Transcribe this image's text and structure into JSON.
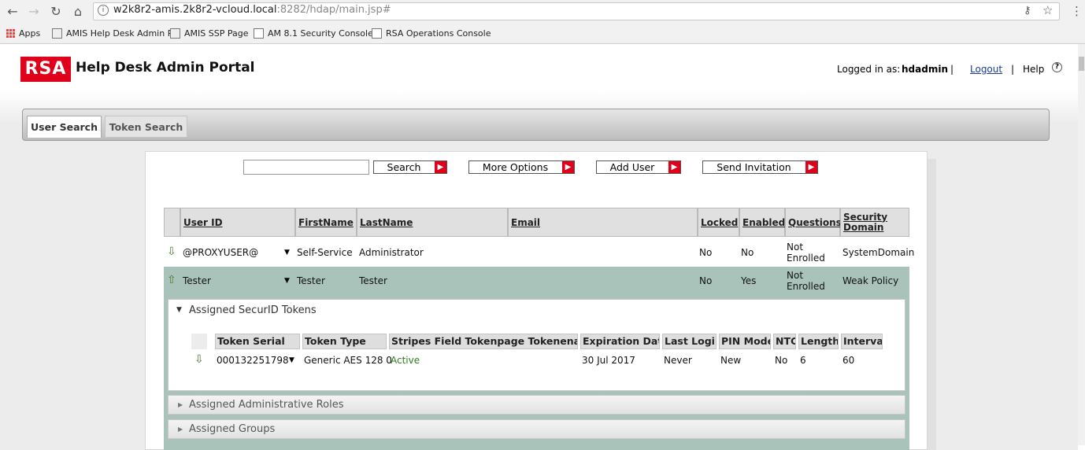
{
  "browser": {
    "url_host": "w2k8r2-amis.2k8r2-vcloud.local",
    "url_rest": ":8282/hdap/main.jsp#",
    "bookmarks": [
      "Apps",
      "AMIS Help Desk Admin P",
      "AMIS SSP Page",
      "AM 8.1 Security Console",
      "RSA Operations Console"
    ]
  },
  "header": {
    "logo_text": "RSA",
    "title": "Help Desk Admin Portal",
    "logged_in_label": "Logged in as:",
    "username": "hdadmin",
    "sep1": "|",
    "logout": "Logout",
    "sep2": "|",
    "help": "Help"
  },
  "tabs": [
    "User Search",
    "Token Search"
  ],
  "toolbar": {
    "search_value": "",
    "search": "Search",
    "more_options": "More Options",
    "add_user": "Add User",
    "send_invitation": "Send Invitation"
  },
  "users_table": {
    "columns": [
      "User ID",
      "FirstName",
      "LastName",
      "Email",
      "Locked",
      "Enabled",
      "Questions",
      "Security Domain"
    ],
    "rows": [
      {
        "user_id": "@PROXYUSER@",
        "first": "Self-Service",
        "last": "Administrator",
        "email": "",
        "locked": "No",
        "enabled": "No",
        "questions": "Not Enrolled",
        "domain": "SystemDomain"
      },
      {
        "user_id": "Tester",
        "first": "Tester",
        "last": "Tester",
        "email": "",
        "locked": "No",
        "enabled": "Yes",
        "questions": "Not Enrolled",
        "domain": "Weak Policy"
      }
    ]
  },
  "details": {
    "tokens_title": "Assigned SecurID Tokens",
    "token_columns": [
      "Token Serial",
      "Token Type",
      "Stripes Field Tokenpage Tokenenabled",
      "Expiration Date",
      "Last Login",
      "PIN Mode",
      "NTC",
      "Length",
      "Interval"
    ],
    "token_row": {
      "serial": "000132251798",
      "type": "Generic AES 128 0",
      "status": "Active",
      "expiration": "30 Jul 2017",
      "last_login": "Never",
      "pin_mode": "New",
      "ntc": "No",
      "length": "6",
      "interval": "60"
    },
    "admin_roles": "Assigned Administrative Roles",
    "groups": "Assigned Groups"
  },
  "colors": {
    "brand": "#e1001a",
    "row_highlight": "#a9c3bb",
    "active_status": "#2e7d1e"
  }
}
